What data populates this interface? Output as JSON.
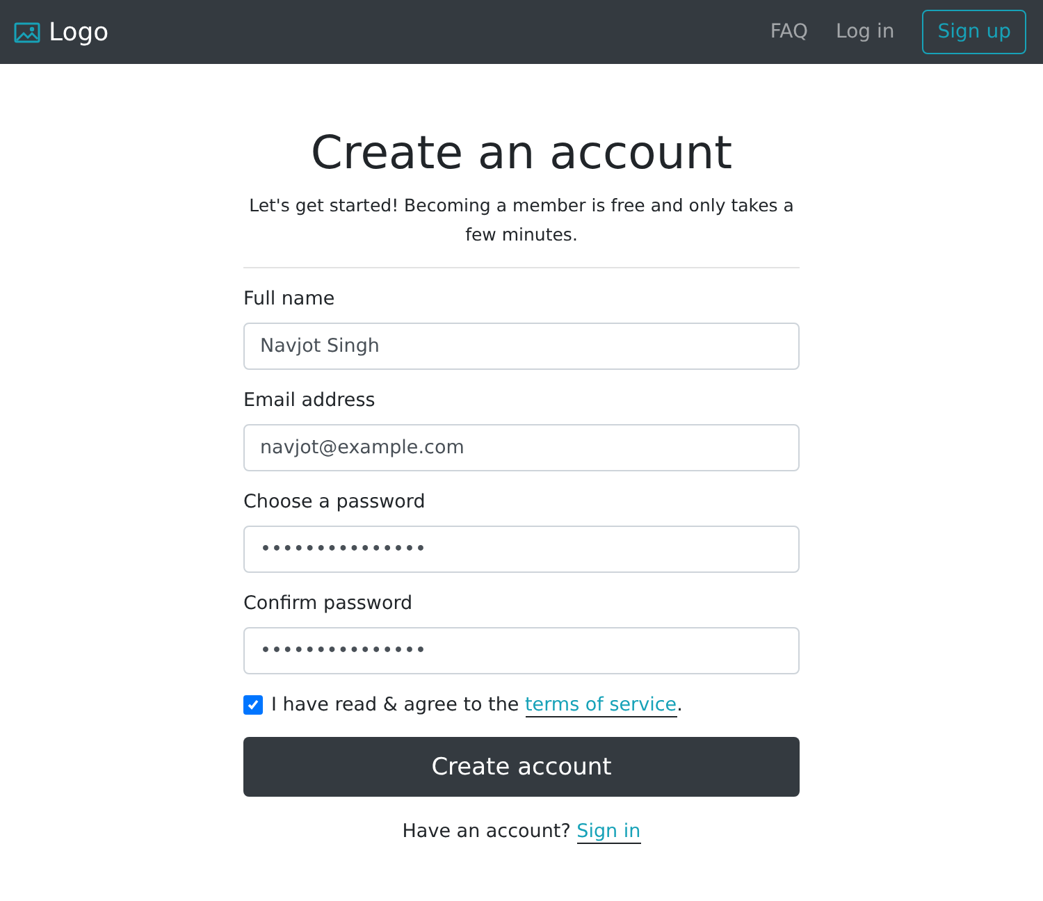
{
  "navbar": {
    "logo": "Logo",
    "links": [
      "FAQ",
      "Log in"
    ],
    "signup_button": "Sign up"
  },
  "title": "Create an account",
  "subtitle": "Let's get started! Becoming a member is free and only takes a few minutes.",
  "fields": [
    {
      "label": "Full name",
      "value": "Navjot Singh"
    },
    {
      "label": "Email address",
      "value": "navjot@example.com"
    },
    {
      "label": "Choose a password",
      "value": "•••••••••••••••"
    },
    {
      "label": "Confirm password",
      "value": "•••••••••••••••"
    }
  ],
  "agree": {
    "checked": true,
    "text_before": "I have read & agree to the",
    "link": "terms of service",
    "text_after": "."
  },
  "submit_button": "Create account",
  "footer": {
    "text": "Have an account?",
    "link": "Sign in"
  }
}
